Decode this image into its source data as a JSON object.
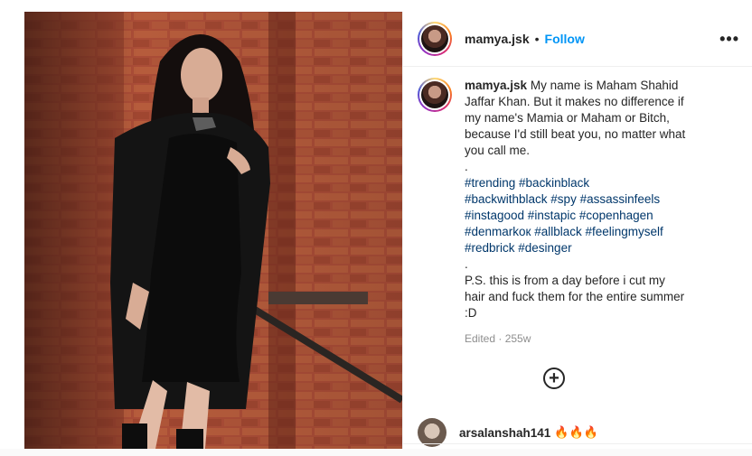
{
  "post": {
    "username": "mamya.jsk",
    "separator": "•",
    "follow_label": "Follow",
    "more_label": "•••"
  },
  "caption": {
    "username": "mamya.jsk",
    "text": "My name is Maham Shahid Jaffar Khan. But it makes no difference if my name's Mamia or Maham or Bitch, because I'd still beat you, no matter what you call me.",
    "dot1": ".",
    "hashtag_lines": [
      "#trending #backinblack",
      "#backwithblack #spy #assassinfeels",
      "#instagood #instapic #copenhagen",
      "#denmarkок #allblack #feelingmyself",
      "#redbrick #desinger"
    ],
    "dot2": ".",
    "ps": "P.S. this is from a day before i cut my hair and fuck them for the entire summer :D",
    "edited": "Edited · 255w"
  },
  "load_more_label": "+",
  "comment": {
    "username": "arsalanshah141",
    "text": "🔥🔥🔥"
  },
  "colors": {
    "link": "#0095f6",
    "hashtag": "#00376b",
    "muted": "#8e8e8e"
  }
}
